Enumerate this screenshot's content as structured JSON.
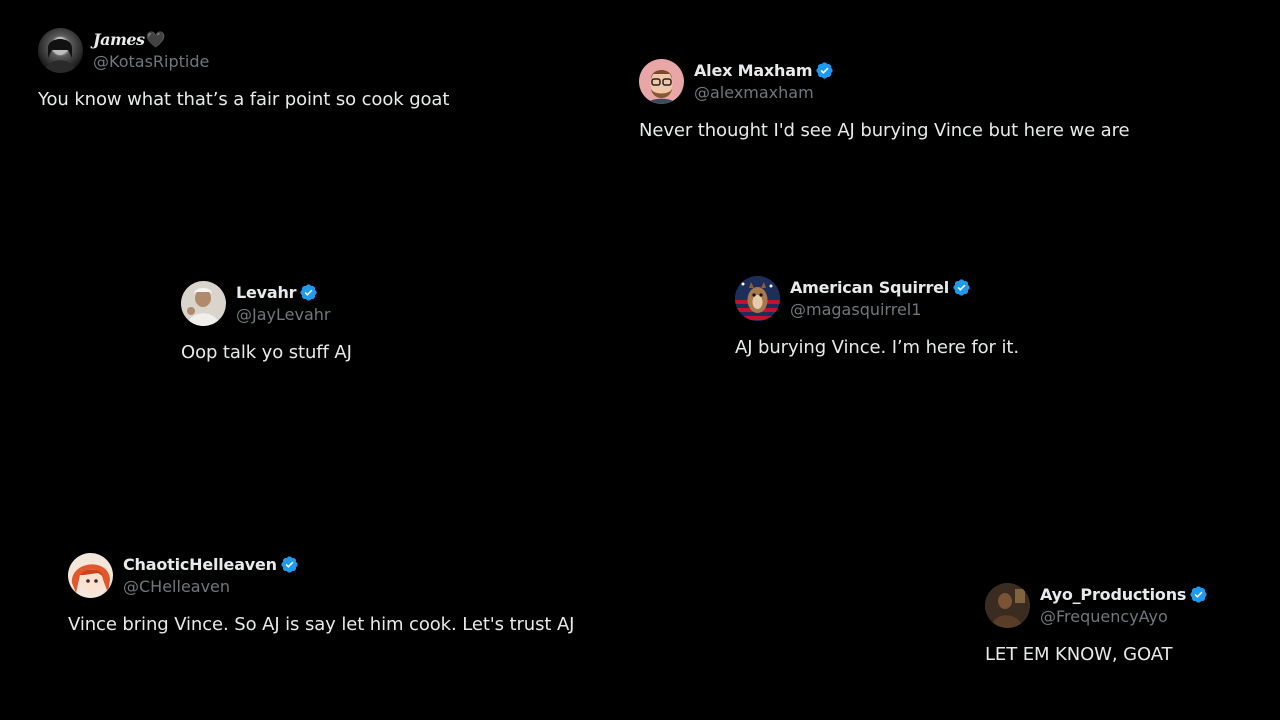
{
  "tweets": [
    {
      "name": "James",
      "name_suffix": "🖤",
      "handle": "@KotasRiptide",
      "text": "You know what that’s a fair point so cook goat",
      "verified": false
    },
    {
      "name": "Alex Maxham",
      "handle": "@alexmaxham",
      "text": "Never thought I'd see AJ burying Vince but here we are",
      "verified": true
    },
    {
      "name": "Levahr",
      "handle": "@JayLevahr",
      "text": "Oop talk yo stuff AJ",
      "verified": true
    },
    {
      "name": "American Squirrel",
      "handle": "@magasquirrel1",
      "text": "AJ burying Vince. I’m here for it.",
      "verified": true
    },
    {
      "name": "ChaoticHelleaven",
      "handle": "@CHelleaven",
      "text": "Vince bring Vince. So AJ is say let him cook. Let's trust AJ",
      "verified": true
    },
    {
      "name": "Ayo_Productions",
      "handle": "@FrequencyAyo",
      "text": "LET EM KNOW, GOAT",
      "verified": true
    }
  ],
  "colors": {
    "background": "#000000",
    "text": "#e7e9ea",
    "handle": "#71767b",
    "verified": "#1d9bf0"
  }
}
